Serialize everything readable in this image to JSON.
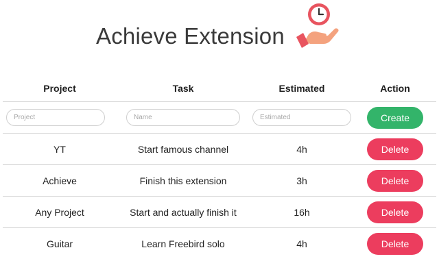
{
  "app": {
    "title": "Achieve Extension",
    "logo_icon": "hand-holding-clock-icon"
  },
  "table": {
    "headers": {
      "project": "Project",
      "task": "Task",
      "estimated": "Estimated",
      "action": "Action"
    },
    "form": {
      "project_placeholder": "Project",
      "task_placeholder": "Name",
      "estimated_placeholder": "Estimated",
      "create_label": "Create"
    },
    "rows": [
      {
        "project": "YT",
        "task": "Start famous channel",
        "estimated": "4h",
        "action": "Delete"
      },
      {
        "project": "Achieve",
        "task": "Finish this extension",
        "estimated": "3h",
        "action": "Delete"
      },
      {
        "project": "Any Project",
        "task": "Start and actually finish it",
        "estimated": "16h",
        "action": "Delete"
      },
      {
        "project": "Guitar",
        "task": "Learn Freebird solo",
        "estimated": "4h",
        "action": "Delete"
      }
    ]
  },
  "colors": {
    "create": "#33b46a",
    "delete": "#ec3d5e",
    "logo_clock": "#e8545f",
    "logo_hand": "#f4a27e"
  }
}
